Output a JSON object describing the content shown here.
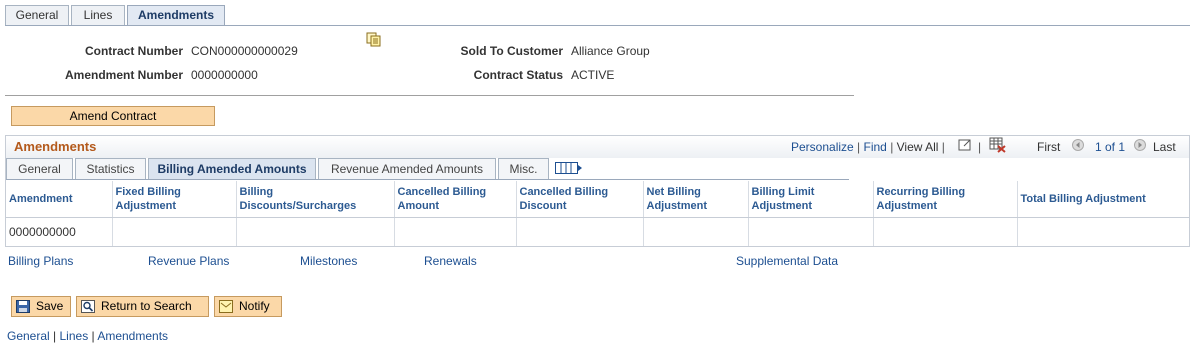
{
  "page_tabs": [
    "General",
    "Lines",
    "Amendments"
  ],
  "header": {
    "contract_number_label": "Contract Number",
    "contract_number": "CON000000000029",
    "amendment_number_label": "Amendment Number",
    "amendment_number": "0000000000",
    "sold_to_label": "Sold To Customer",
    "sold_to": "Alliance Group",
    "status_label": "Contract Status",
    "status": "ACTIVE"
  },
  "amend_button": "Amend Contract",
  "grid": {
    "title": "Amendments",
    "personalize": "Personalize",
    "find": "Find",
    "view_all": "View All",
    "first": "First",
    "range": "1 of 1",
    "last": "Last",
    "tabs": [
      "General",
      "Statistics",
      "Billing Amended Amounts",
      "Revenue Amended Amounts",
      "Misc."
    ],
    "columns": [
      "Amendment",
      "Fixed Billing Adjustment",
      "Billing Discounts/Surcharges",
      "Cancelled Billing Amount",
      "Cancelled Billing Discount",
      "Net Billing Adjustment",
      "Billing Limit Adjustment",
      "Recurring Billing Adjustment",
      "Total Billing Adjustment"
    ],
    "rows": [
      [
        "0000000000",
        "",
        "",
        "",
        "",
        "",
        "",
        "",
        ""
      ]
    ]
  },
  "page_links": [
    "Billing Plans",
    "Revenue Plans",
    "Milestones",
    "Renewals",
    "Supplemental Data"
  ],
  "toolbar": {
    "save": "Save",
    "return_to_search": "Return to Search",
    "notify": "Notify"
  },
  "footer_links": [
    "General",
    "Lines",
    "Amendments"
  ],
  "colors": {
    "accent_button": "#fbd8a8",
    "grid_title": "#b45a1c",
    "link": "#1d4f91"
  }
}
